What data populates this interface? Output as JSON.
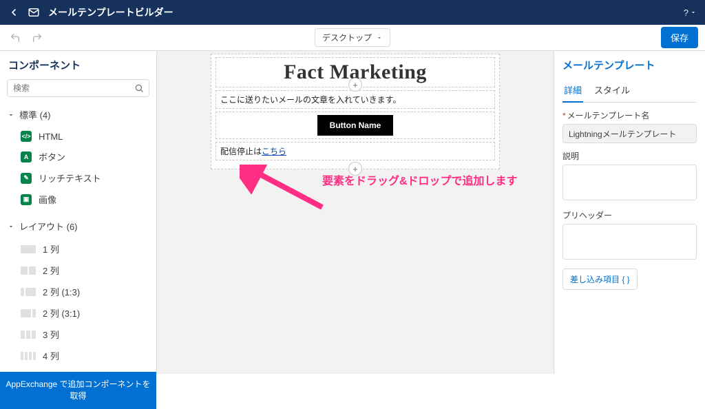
{
  "header": {
    "title": "メールテンプレートビルダー",
    "help_label": "?"
  },
  "toolbar": {
    "view_label": "デスクトップ",
    "save_label": "保存"
  },
  "sidebar": {
    "title": "コンポーネント",
    "search_placeholder": "検索",
    "sections": {
      "standard": {
        "label": "標準 (4)"
      },
      "layout": {
        "label": "レイアウト (6)"
      }
    },
    "standard_items": [
      {
        "label": "HTML"
      },
      {
        "label": "ボタン"
      },
      {
        "label": "リッチテキスト"
      },
      {
        "label": "画像"
      }
    ],
    "layout_items": [
      {
        "label": "1 列"
      },
      {
        "label": "2 列"
      },
      {
        "label": "2 列 (1:3)"
      },
      {
        "label": "2 列 (3:1)"
      },
      {
        "label": "3 列"
      },
      {
        "label": "4 列"
      }
    ],
    "footer_label": "AppExchange で追加コンポーネントを取得"
  },
  "canvas": {
    "title_text": "Fact Marketing",
    "body_text": "ここに送りたいメールの文章を入れていきます。",
    "button_label": "Button Name",
    "unsubscribe_prefix": "配信停止は",
    "unsubscribe_link": "こちら",
    "annotation_text": "要素をドラッグ&ドロップで追加します"
  },
  "right": {
    "panel_title": "メールテンプレート",
    "tabs": {
      "details": "詳細",
      "style": "スタイル"
    },
    "name_label": "メールテンプレート名",
    "name_value": "Lightningメールテンプレート",
    "desc_label": "説明",
    "preheader_label": "プリヘッダー",
    "merge_label": "差し込み項目  { }"
  }
}
